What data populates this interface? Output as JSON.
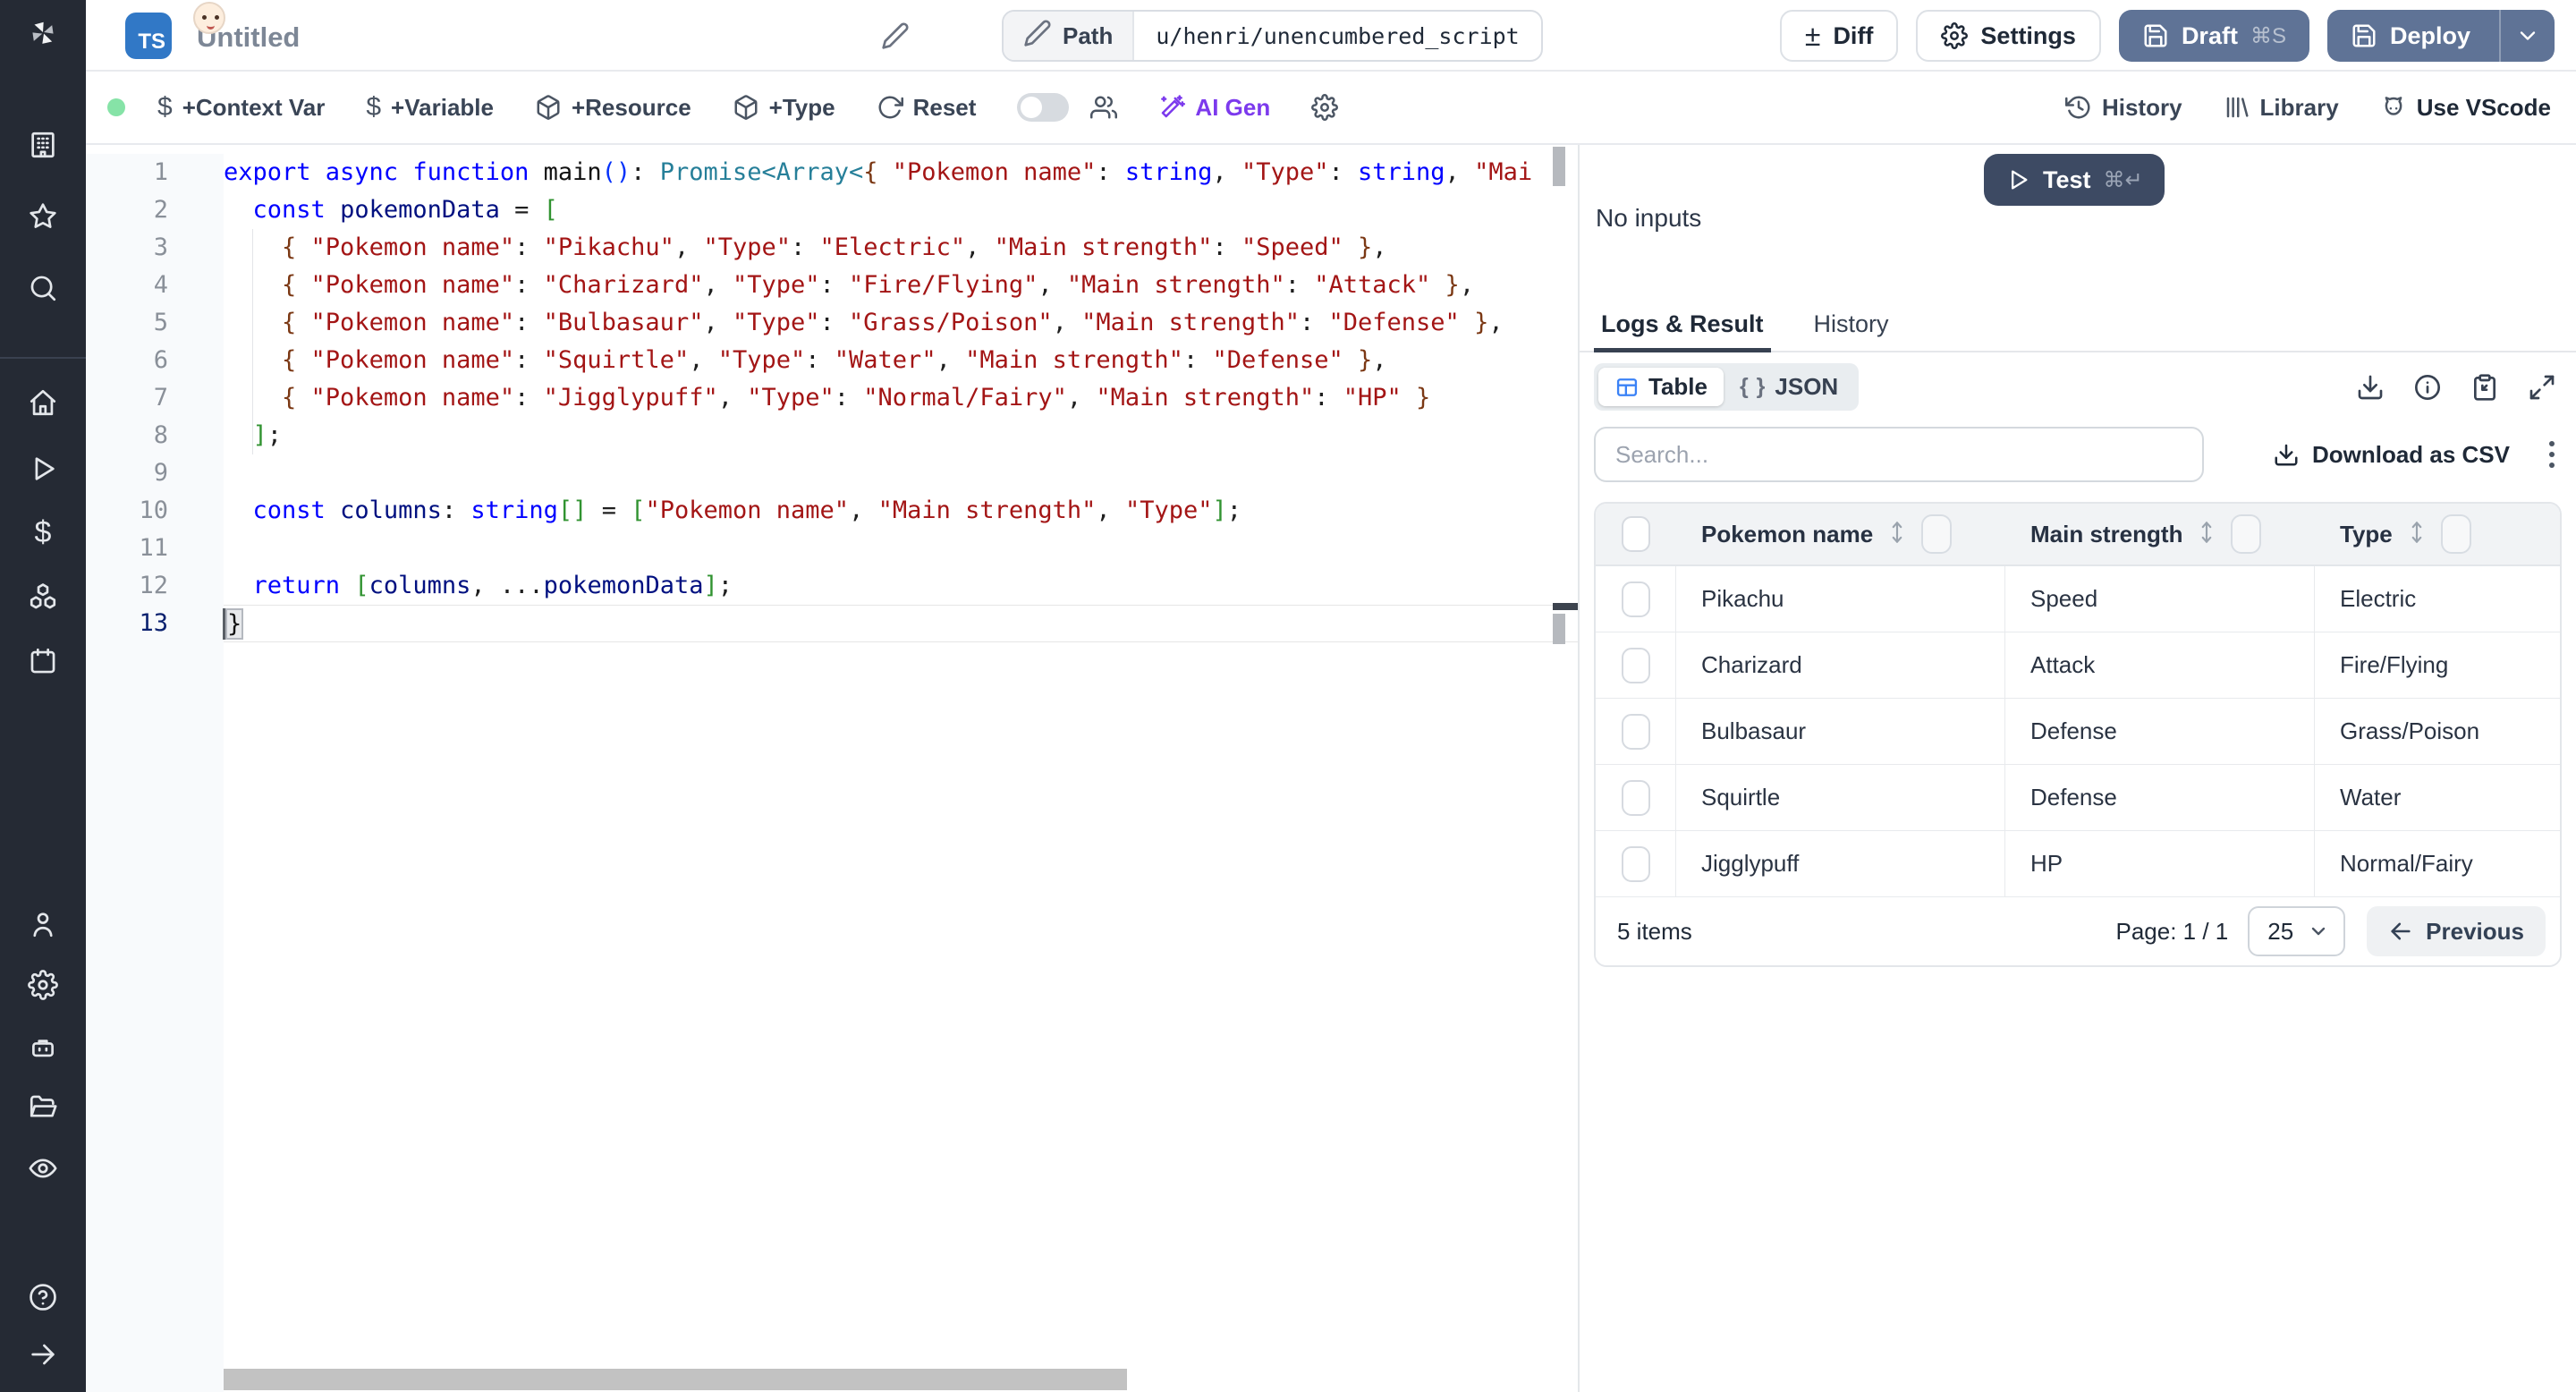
{
  "header": {
    "badge": "TS",
    "title": "Untitled",
    "path_label": "Path",
    "path_value": "u/henri/unencumbered_script",
    "diff": "Diff",
    "settings": "Settings",
    "draft": "Draft",
    "draft_shortcut": "⌘S",
    "deploy": "Deploy"
  },
  "toolbar": {
    "context_var": "+Context Var",
    "variable": "+Variable",
    "resource": "+Resource",
    "type": "+Type",
    "reset": "Reset",
    "ai_gen": "AI Gen",
    "history": "History",
    "library": "Library",
    "vscode": "Use VScode"
  },
  "editor": {
    "active_line": 13,
    "lines": [
      {
        "n": 1,
        "tokens": [
          [
            "kw",
            "export async function "
          ],
          [
            "fn",
            "main"
          ],
          [
            "b1",
            "()"
          ],
          [
            "pl",
            ": "
          ],
          [
            "ty",
            "Promise<Array<"
          ],
          [
            "b3",
            "{ "
          ],
          [
            "st",
            "\"Pokemon name\""
          ],
          [
            "pl",
            ": "
          ],
          [
            "kw",
            "string"
          ],
          [
            "pl",
            ", "
          ],
          [
            "st",
            "\"Type\""
          ],
          [
            "pl",
            ": "
          ],
          [
            "kw",
            "string"
          ],
          [
            "pl",
            ", "
          ],
          [
            "st",
            "\"Mai"
          ]
        ]
      },
      {
        "n": 2,
        "tokens": [
          [
            "pl",
            "  "
          ],
          [
            "kw",
            "const"
          ],
          [
            "pl",
            " "
          ],
          [
            "vr",
            "pokemonData"
          ],
          [
            "pl",
            " = "
          ],
          [
            "b2",
            "["
          ]
        ]
      },
      {
        "n": 3,
        "tokens": [
          [
            "pl",
            "    "
          ],
          [
            "b3",
            "{ "
          ],
          [
            "st",
            "\"Pokemon name\""
          ],
          [
            "pl",
            ": "
          ],
          [
            "st",
            "\"Pikachu\""
          ],
          [
            "pl",
            ", "
          ],
          [
            "st",
            "\"Type\""
          ],
          [
            "pl",
            ": "
          ],
          [
            "st",
            "\"Electric\""
          ],
          [
            "pl",
            ", "
          ],
          [
            "st",
            "\"Main strength\""
          ],
          [
            "pl",
            ": "
          ],
          [
            "st",
            "\"Speed\""
          ],
          [
            "pl",
            " "
          ],
          [
            "b3",
            "}"
          ],
          [
            "pl",
            ","
          ]
        ]
      },
      {
        "n": 4,
        "tokens": [
          [
            "pl",
            "    "
          ],
          [
            "b3",
            "{ "
          ],
          [
            "st",
            "\"Pokemon name\""
          ],
          [
            "pl",
            ": "
          ],
          [
            "st",
            "\"Charizard\""
          ],
          [
            "pl",
            ", "
          ],
          [
            "st",
            "\"Type\""
          ],
          [
            "pl",
            ": "
          ],
          [
            "st",
            "\"Fire/Flying\""
          ],
          [
            "pl",
            ", "
          ],
          [
            "st",
            "\"Main strength\""
          ],
          [
            "pl",
            ": "
          ],
          [
            "st",
            "\"Attack\""
          ],
          [
            "pl",
            " "
          ],
          [
            "b3",
            "}"
          ],
          [
            "pl",
            ","
          ]
        ]
      },
      {
        "n": 5,
        "tokens": [
          [
            "pl",
            "    "
          ],
          [
            "b3",
            "{ "
          ],
          [
            "st",
            "\"Pokemon name\""
          ],
          [
            "pl",
            ": "
          ],
          [
            "st",
            "\"Bulbasaur\""
          ],
          [
            "pl",
            ", "
          ],
          [
            "st",
            "\"Type\""
          ],
          [
            "pl",
            ": "
          ],
          [
            "st",
            "\"Grass/Poison\""
          ],
          [
            "pl",
            ", "
          ],
          [
            "st",
            "\"Main strength\""
          ],
          [
            "pl",
            ": "
          ],
          [
            "st",
            "\"Defense\""
          ],
          [
            "pl",
            " "
          ],
          [
            "b3",
            "}"
          ],
          [
            "pl",
            ","
          ]
        ]
      },
      {
        "n": 6,
        "tokens": [
          [
            "pl",
            "    "
          ],
          [
            "b3",
            "{ "
          ],
          [
            "st",
            "\"Pokemon name\""
          ],
          [
            "pl",
            ": "
          ],
          [
            "st",
            "\"Squirtle\""
          ],
          [
            "pl",
            ", "
          ],
          [
            "st",
            "\"Type\""
          ],
          [
            "pl",
            ": "
          ],
          [
            "st",
            "\"Water\""
          ],
          [
            "pl",
            ", "
          ],
          [
            "st",
            "\"Main strength\""
          ],
          [
            "pl",
            ": "
          ],
          [
            "st",
            "\"Defense\""
          ],
          [
            "pl",
            " "
          ],
          [
            "b3",
            "}"
          ],
          [
            "pl",
            ","
          ]
        ]
      },
      {
        "n": 7,
        "tokens": [
          [
            "pl",
            "    "
          ],
          [
            "b3",
            "{ "
          ],
          [
            "st",
            "\"Pokemon name\""
          ],
          [
            "pl",
            ": "
          ],
          [
            "st",
            "\"Jigglypuff\""
          ],
          [
            "pl",
            ", "
          ],
          [
            "st",
            "\"Type\""
          ],
          [
            "pl",
            ": "
          ],
          [
            "st",
            "\"Normal/Fairy\""
          ],
          [
            "pl",
            ", "
          ],
          [
            "st",
            "\"Main strength\""
          ],
          [
            "pl",
            ": "
          ],
          [
            "st",
            "\"HP\""
          ],
          [
            "pl",
            " "
          ],
          [
            "b3",
            "}"
          ]
        ]
      },
      {
        "n": 8,
        "tokens": [
          [
            "pl",
            "  "
          ],
          [
            "b2",
            "]"
          ],
          [
            "pl",
            ";"
          ]
        ]
      },
      {
        "n": 9,
        "tokens": []
      },
      {
        "n": 10,
        "tokens": [
          [
            "pl",
            "  "
          ],
          [
            "kw",
            "const"
          ],
          [
            "pl",
            " "
          ],
          [
            "vr",
            "columns"
          ],
          [
            "pl",
            ": "
          ],
          [
            "kw",
            "string"
          ],
          [
            "b2",
            "[]"
          ],
          [
            "pl",
            " = "
          ],
          [
            "b2",
            "["
          ],
          [
            "st",
            "\"Pokemon name\""
          ],
          [
            "pl",
            ", "
          ],
          [
            "st",
            "\"Main strength\""
          ],
          [
            "pl",
            ", "
          ],
          [
            "st",
            "\"Type\""
          ],
          [
            "b2",
            "]"
          ],
          [
            "pl",
            ";"
          ]
        ]
      },
      {
        "n": 11,
        "tokens": []
      },
      {
        "n": 12,
        "tokens": [
          [
            "pl",
            "  "
          ],
          [
            "kw",
            "return"
          ],
          [
            "pl",
            " "
          ],
          [
            "b2",
            "["
          ],
          [
            "vr",
            "columns"
          ],
          [
            "pl",
            ", ..."
          ],
          [
            "vr",
            "pokemonData"
          ],
          [
            "b2",
            "]"
          ],
          [
            "pl",
            ";"
          ]
        ]
      },
      {
        "n": 13,
        "tokens": [
          [
            "bm",
            "}"
          ]
        ]
      }
    ]
  },
  "panel": {
    "test": "Test",
    "test_shortcut": "⌘↵",
    "no_inputs": "No inputs",
    "tabs": {
      "logs": "Logs & Result",
      "history": "History"
    },
    "view": {
      "table": "Table",
      "json": "JSON"
    },
    "search_placeholder": "Search...",
    "download_csv": "Download as CSV",
    "table": {
      "columns": [
        "Pokemon name",
        "Main strength",
        "Type"
      ],
      "rows": [
        [
          "Pikachu",
          "Speed",
          "Electric"
        ],
        [
          "Charizard",
          "Attack",
          "Fire/Flying"
        ],
        [
          "Bulbasaur",
          "Defense",
          "Grass/Poison"
        ],
        [
          "Squirtle",
          "Defense",
          "Water"
        ],
        [
          "Jigglypuff",
          "HP",
          "Normal/Fairy"
        ]
      ]
    },
    "footer": {
      "items": "5 items",
      "page": "Page: 1 / 1",
      "page_size": "25",
      "previous": "Previous"
    }
  },
  "colors": {
    "sidebar_bg": "#252a34",
    "primary_button": "#5f7396",
    "test_button": "#3d4a63",
    "ai_purple": "#7c3aed",
    "status_green": "#86e3a7",
    "ts_badge_blue": "#3178c6"
  }
}
